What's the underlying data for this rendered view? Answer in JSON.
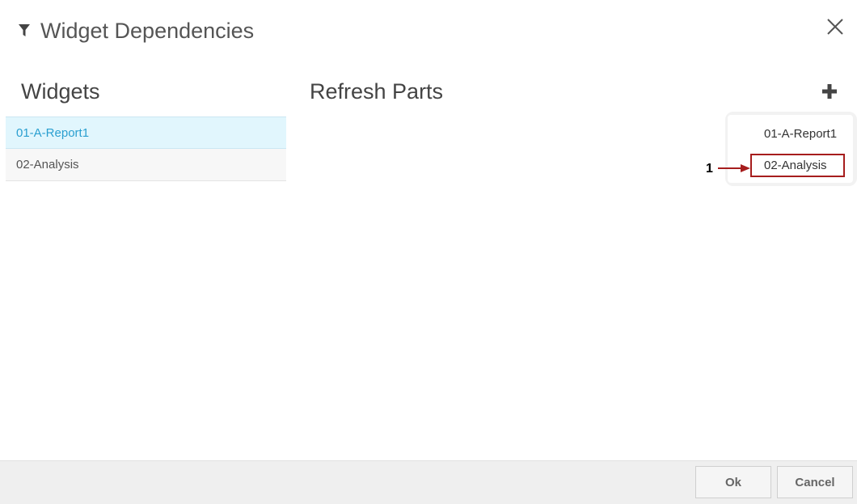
{
  "dialog": {
    "title": "Widget Dependencies",
    "title_icon": "filter-icon",
    "close_icon": "close-icon"
  },
  "widgets": {
    "heading": "Widgets",
    "items": [
      {
        "label": "01-A-Report1",
        "selected": true
      },
      {
        "label": "02-Analysis",
        "selected": false
      }
    ]
  },
  "refresh_parts": {
    "heading": "Refresh Parts",
    "add_icon": "plus-icon",
    "dropdown_items": [
      "01-A-Report1",
      "02-Analysis"
    ]
  },
  "annotation": {
    "number": "1",
    "color": "#a61d1d"
  },
  "footer": {
    "ok_label": "Ok",
    "cancel_label": "Cancel"
  },
  "colors": {
    "selected_bg": "#e1f6fd",
    "selected_text": "#2a9fd0",
    "footer_bg": "#efefef"
  }
}
